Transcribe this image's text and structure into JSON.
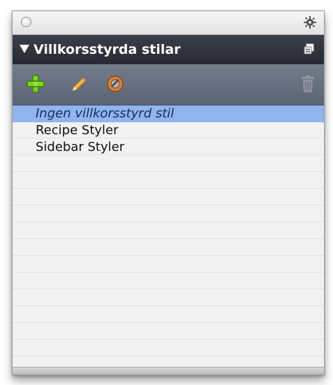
{
  "window": {
    "close_button": "close-button",
    "settings_icon": "gear-icon"
  },
  "panel": {
    "title": "Villkorsstyrda stilar",
    "expanded": true,
    "menu_icon": "panel-menu-icon"
  },
  "toolbar": {
    "tools": [
      {
        "icon": "plus-icon",
        "color": "#7ed321"
      },
      {
        "icon": "pencil-icon",
        "color": "#f2b84b"
      },
      {
        "icon": "link-icon",
        "color": "#d9823b"
      },
      {
        "icon": "trash-icon",
        "color": "#8c93a0"
      }
    ]
  },
  "list": {
    "items": [
      {
        "label": "Ingen villkorsstyrd stil",
        "selected": true
      },
      {
        "label": "Recipe Styler",
        "selected": false
      },
      {
        "label": "Sidebar Styler",
        "selected": false
      }
    ]
  },
  "colors": {
    "selection": "#8fb5ee",
    "titlebar": "#2c3038",
    "toolbar": "#687080"
  }
}
